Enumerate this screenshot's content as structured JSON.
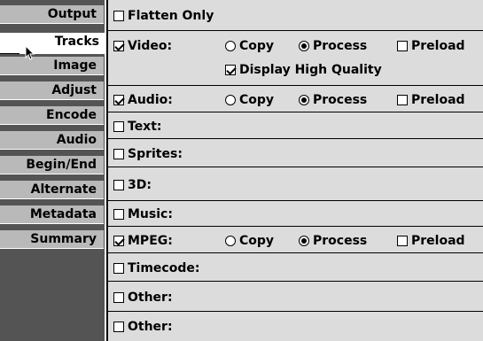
{
  "tabs": [
    {
      "label": "Output"
    },
    {
      "label": "Tracks"
    },
    {
      "label": "Image"
    },
    {
      "label": "Adjust"
    },
    {
      "label": "Encode"
    },
    {
      "label": "Audio"
    },
    {
      "label": "Begin/End"
    },
    {
      "label": "Alternate"
    },
    {
      "label": "Metadata"
    },
    {
      "label": "Summary"
    }
  ],
  "active_tab": "Tracks",
  "options": {
    "flatten_only": "Flatten Only",
    "copy": "Copy",
    "process": "Process",
    "preload": "Preload",
    "display_high_quality": "Display High Quality"
  },
  "tracks": {
    "video": "Video:",
    "audio": "Audio:",
    "text": "Text:",
    "sprites": "Sprites:",
    "threed": "3D:",
    "music": "Music:",
    "mpeg": "MPEG:",
    "timecode": "Timecode:",
    "other1": "Other:",
    "other2": "Other:"
  },
  "state": {
    "flatten_only": false,
    "video": true,
    "video_mode": "Process",
    "video_preload": false,
    "video_display_hq": true,
    "audio": true,
    "audio_mode": "Process",
    "audio_preload": false,
    "text": false,
    "sprites": false,
    "threed": false,
    "music": false,
    "mpeg": true,
    "mpeg_mode": "Process",
    "mpeg_preload": false,
    "timecode": false,
    "other1": false,
    "other2": false
  },
  "colors": {
    "tab_bg": "#b9b9b9",
    "tab_strip_bg": "#545454",
    "panel_bg": "#dcdcdc"
  }
}
